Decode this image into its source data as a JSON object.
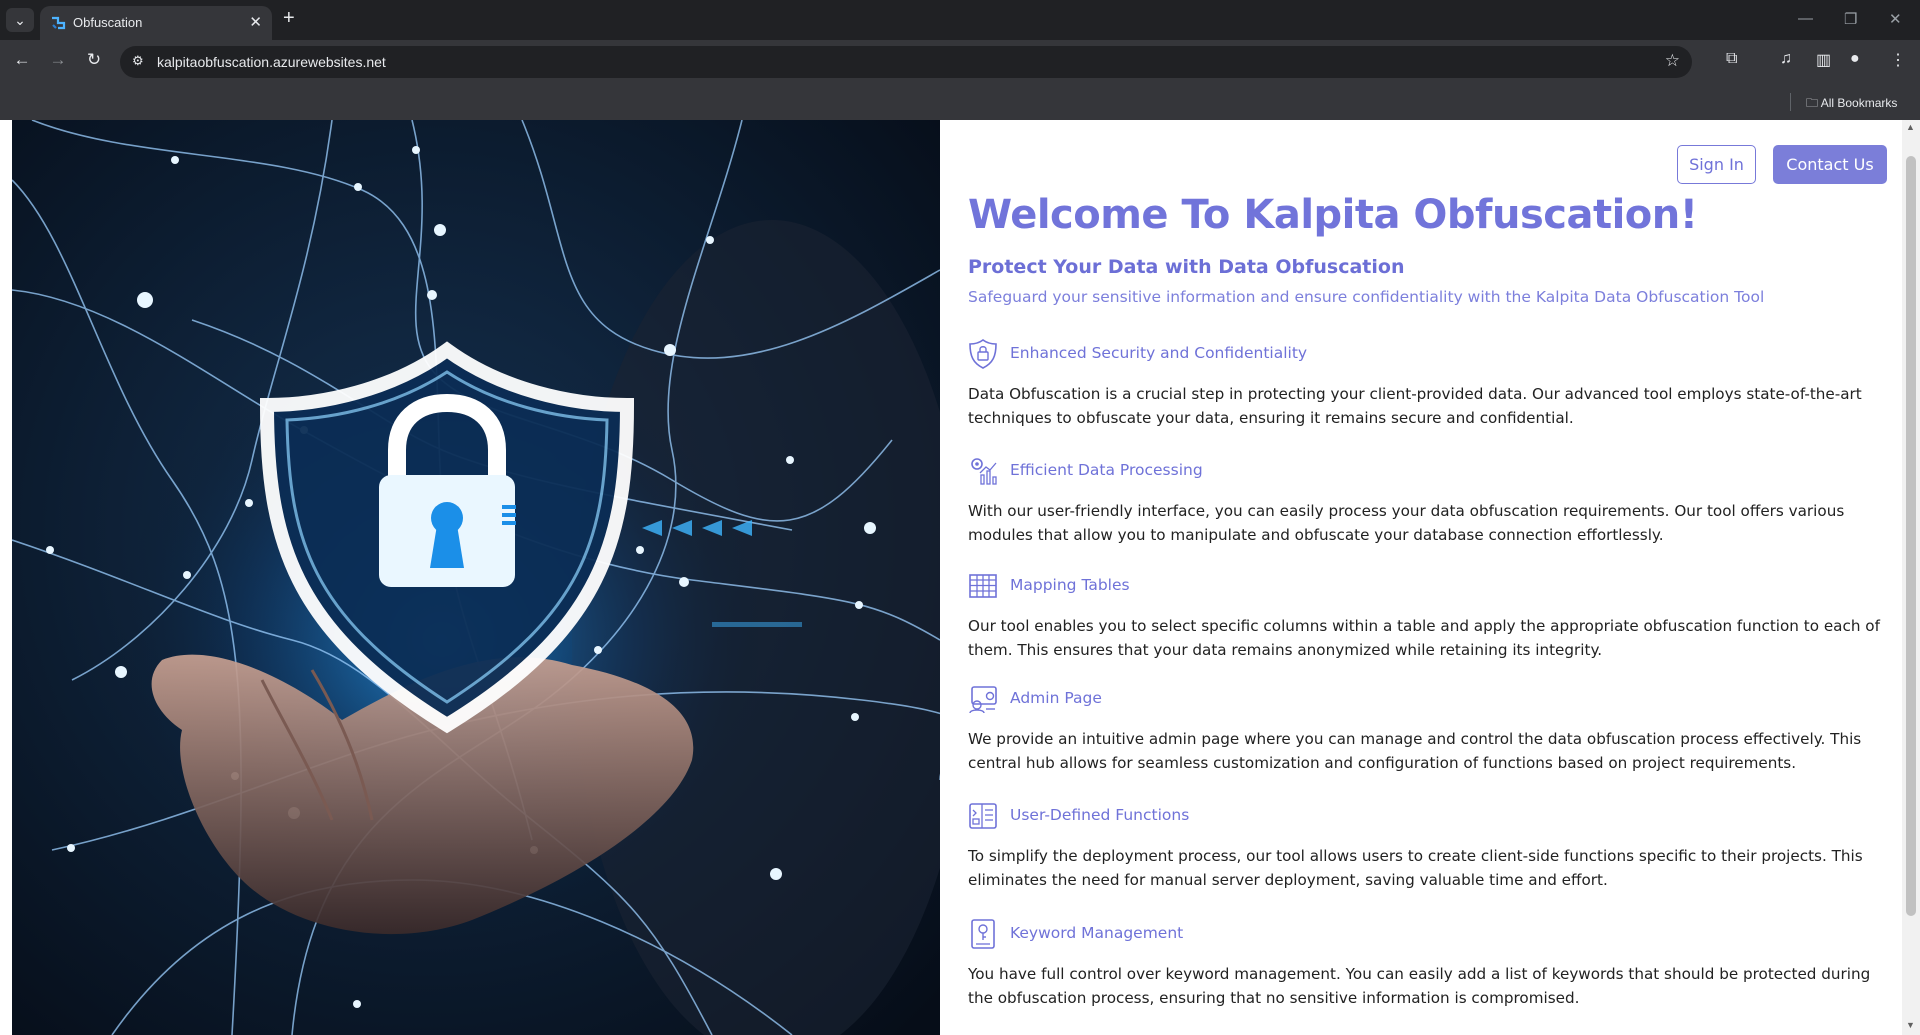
{
  "browser": {
    "tab_title": "Obfuscation",
    "url": "kalpitaobfuscation.azurewebsites.net",
    "bookmarks_label": "All Bookmarks"
  },
  "header": {
    "sign_in_label": "Sign In",
    "contact_label": "Contact Us"
  },
  "hero": {
    "title": "Welcome To Kalpita Obfuscation!",
    "subtitle": "Protect Your Data with Data Obfuscation",
    "tagline": "Safeguard your sensitive information and ensure confidentiality with the Kalpita Data Obfuscation Tool"
  },
  "features": [
    {
      "icon": "shield-lock-icon",
      "title": "Enhanced Security and Confidentiality",
      "description": "Data Obfuscation is a crucial step in protecting your client-provided data. Our advanced tool employs state-of-the-art techniques to obfuscate your data, ensuring it remains secure and confidential."
    },
    {
      "icon": "data-processing-icon",
      "title": "Efficient Data Processing",
      "description": "With our user-friendly interface, you can easily process your data obfuscation requirements. Our tool offers various modules that allow you to manipulate and obfuscate your database connection effortlessly."
    },
    {
      "icon": "table-icon",
      "title": "Mapping Tables",
      "description": "Our tool enables you to select specific columns within a table and apply the appropriate obfuscation function to each of them. This ensures that your data remains anonymized while retaining its integrity."
    },
    {
      "icon": "admin-icon",
      "title": "Admin Page",
      "description": "We provide an intuitive admin page where you can manage and control the data obfuscation process effectively. This central hub allows for seamless customization and configuration of functions based on project requirements."
    },
    {
      "icon": "functions-icon",
      "title": "User-Defined Functions",
      "description": "To simplify the deployment process, our tool allows users to create client-side functions specific to their projects. This eliminates the need for manual server deployment, saving valuable time and effort."
    },
    {
      "icon": "keyword-icon",
      "title": "Keyword Management",
      "description": "You have full control over keyword management. You can easily add a list of keywords that should be protected during the obfuscation process, ensuring that no sensitive information is compromised."
    }
  ]
}
